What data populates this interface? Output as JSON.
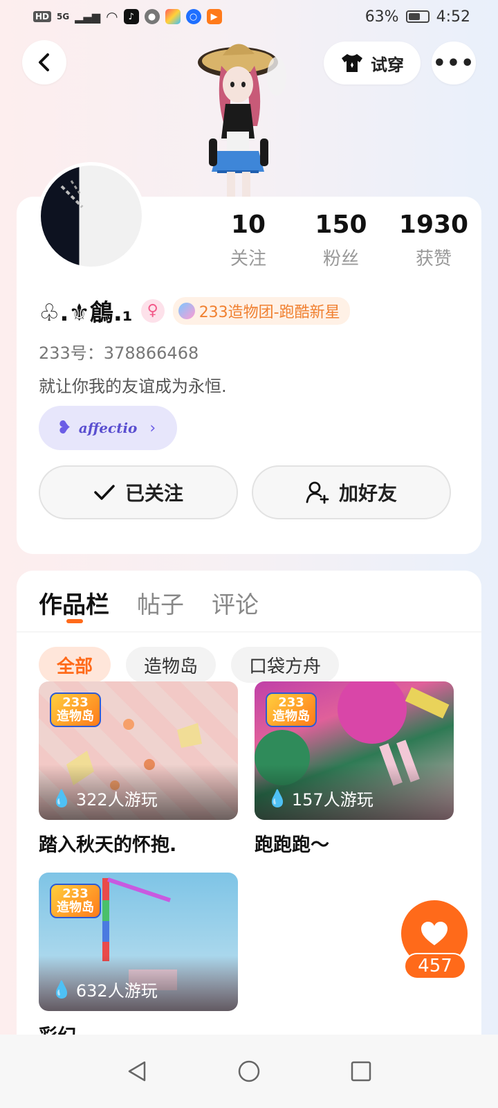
{
  "status_bar": {
    "network": "HD",
    "signal": "5G",
    "battery_percent": "63%",
    "battery_level": 0.63,
    "time": "4:52"
  },
  "header": {
    "back_icon": "back-chevron-icon",
    "try_on_label": "试穿",
    "try_on_icon": "tshirt-icon",
    "more_icon": "more-dots-icon"
  },
  "profile": {
    "stats": [
      {
        "value": "10",
        "label": "关注"
      },
      {
        "value": "150",
        "label": "粉丝"
      },
      {
        "value": "1930",
        "label": "获赞"
      }
    ],
    "nickname": "♧.⚜鶬.₁",
    "gender_icon": "female-icon",
    "title_badge": "233造物团-跑酷新星",
    "user_id": "233号：378866468",
    "bio": "就让你我的友谊成为永恒.",
    "affection_label": "affectio",
    "follow_button": "已关注",
    "add_friend_button": "加好友"
  },
  "works": {
    "tabs": [
      "作品栏",
      "帖子",
      "评论"
    ],
    "active_tab": "作品栏",
    "filters": [
      "全部",
      "造物岛",
      "口袋方舟"
    ],
    "active_filter": "全部",
    "logo_text": "233\n造物岛",
    "games": [
      {
        "title": "踏入秋天的怀抱.",
        "plays": "322人游玩"
      },
      {
        "title": "跑跑跑～",
        "plays": "157人游玩"
      },
      {
        "title": "彩幻",
        "plays": "632人游玩"
      }
    ]
  },
  "like_fab": {
    "icon": "heart-icon",
    "count": "457"
  },
  "colors": {
    "accent": "#ff6a1a",
    "affection_bg": "#e7e6fb",
    "gender_pink": "#f25a8a"
  }
}
